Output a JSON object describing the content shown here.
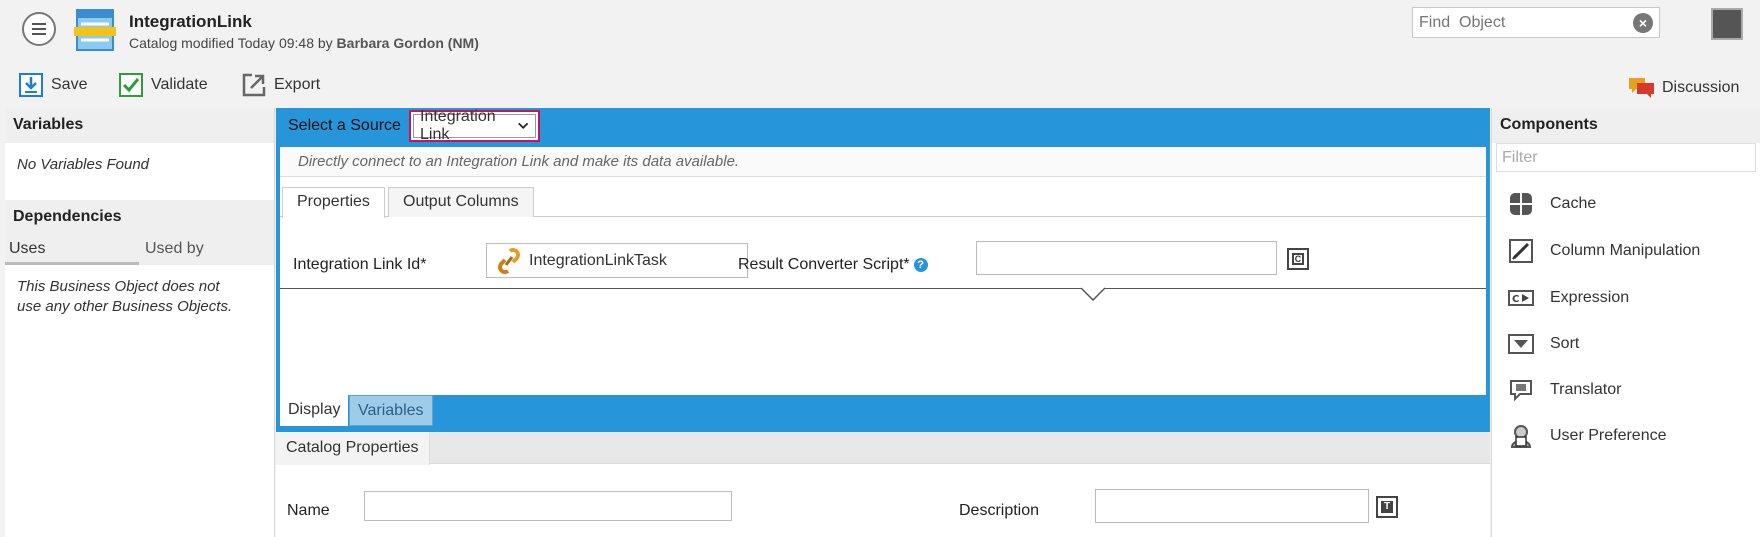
{
  "header": {
    "title": "IntegrationLink",
    "subtitle_prefix": "Catalog modified Today 09:48 by",
    "subtitle_user": "Barbara Gordon (NM)",
    "find_placeholder": "Find  Object"
  },
  "toolbar": {
    "save_label": "Save",
    "validate_label": "Validate",
    "export_label": "Export",
    "discussion_label": "Discussion"
  },
  "left_panel": {
    "variables_title": "Variables",
    "no_variables": "No Variables Found",
    "dependencies_title": "Dependencies",
    "tab_uses": "Uses",
    "tab_used_by": "Used by",
    "uses_message": "This Business Object does not use any other Business Objects."
  },
  "center": {
    "select_source_label": "Select a Source",
    "source_value": "Integration Link",
    "description": "Directly connect to an Integration Link and make its data available.",
    "tabs": [
      "Properties",
      "Output Columns"
    ],
    "integration_link_id_label": "Integration Link Id*",
    "integration_link_id_value": "IntegrationLinkTask",
    "result_converter_label": "Result Converter Script*",
    "result_converter_value": "",
    "bottom_tabs": [
      "Display",
      "Variables"
    ]
  },
  "catalog": {
    "tab_label": "Catalog Properties",
    "name_label": "Name",
    "name_value": "",
    "description_label": "Description",
    "description_value": ""
  },
  "components": {
    "title": "Components",
    "filter_placeholder": "Filter",
    "items": [
      {
        "label": "Cache",
        "icon": "cache-icon"
      },
      {
        "label": "Column Manipulation",
        "icon": "column-manipulation-icon"
      },
      {
        "label": "Expression",
        "icon": "expression-icon"
      },
      {
        "label": "Sort",
        "icon": "sort-icon"
      },
      {
        "label": "Translator",
        "icon": "translator-icon"
      },
      {
        "label": "User Preference",
        "icon": "user-preference-icon"
      }
    ]
  },
  "colors": {
    "accent_blue": "#2795d9",
    "highlight_border": "#c2185b",
    "validate_green": "#2e9e3b"
  }
}
